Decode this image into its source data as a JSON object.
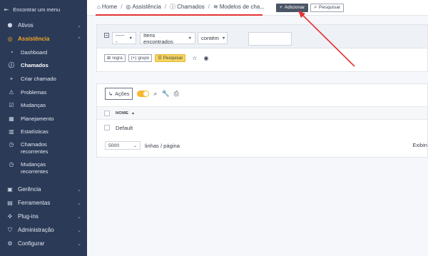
{
  "sidebar": {
    "collapse_label": "Encontrar um menu",
    "items": [
      {
        "label": "Ativos",
        "icon": "cube-icon"
      },
      {
        "label": "Assistência",
        "icon": "headset-icon",
        "active": true
      },
      {
        "label": "Gerência",
        "icon": "wallet-icon"
      },
      {
        "label": "Ferramentas",
        "icon": "briefcase-icon"
      },
      {
        "label": "Plug-ins",
        "icon": "puzzle-icon"
      },
      {
        "label": "Administração",
        "icon": "shield-icon"
      },
      {
        "label": "Configurar",
        "icon": "gear-icon"
      }
    ],
    "subitems": [
      {
        "label": "Dashboard",
        "icon": "gauge-icon"
      },
      {
        "label": "Chamados",
        "icon": "info-icon",
        "current": true
      },
      {
        "label": "Criar chamado",
        "icon": "plus-icon"
      },
      {
        "label": "Problemas",
        "icon": "warning-icon"
      },
      {
        "label": "Mudanças",
        "icon": "clipboard-check-icon"
      },
      {
        "label": "Planejamento",
        "icon": "calendar-icon"
      },
      {
        "label": "Estatísticas",
        "icon": "chart-icon"
      },
      {
        "label": "Chamados recorrentes",
        "icon": "clock-icon"
      },
      {
        "label": "Mudanças recorrentes",
        "icon": "clock-icon"
      }
    ],
    "active_color": "#f5a524",
    "background": "#2b3a57"
  },
  "header": {
    "breadcrumbs": [
      "Home",
      "Assistência",
      "Chamados",
      "Modelos de cha..."
    ],
    "add_label": "Adicionar",
    "search_label": "Pesquisar"
  },
  "filter": {
    "field_select": "------",
    "criteria_select": "Itens encontrados",
    "operator_select": "contém",
    "value": "",
    "rule_label": "regra",
    "group_label": "grupo",
    "search_label": "Pesquisar"
  },
  "table": {
    "actions_label": "Ações",
    "column_header": "NOME",
    "rows": [
      "Default"
    ],
    "page_size": "5000",
    "page_size_label": "linhas / página",
    "display_label": "Exibin"
  },
  "annotation_color": "#e53333"
}
